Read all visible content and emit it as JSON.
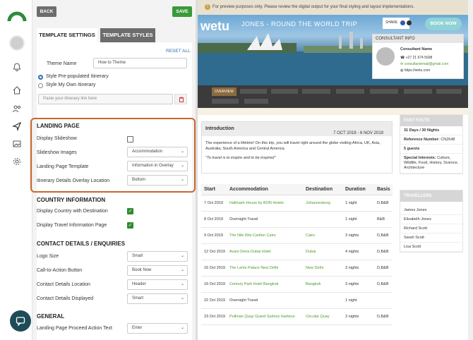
{
  "toolbar": {
    "back_label": "BACK",
    "save_label": "SAVE"
  },
  "tabs": [
    {
      "label": "TEMPLATE SETTINGS"
    },
    {
      "label": "TEMPLATE STYLES"
    }
  ],
  "form": {
    "reset_all": "RESET ALL",
    "theme_name_label": "Theme Name",
    "theme_name_value": "How to Theme",
    "radio_prepopulated": "Style Pre-populated Itinerary",
    "radio_own": "Style My Own Itinerary",
    "itinerary_link_placeholder": "Paste your itinerary link here",
    "landing_page": {
      "heading": "LANDING PAGE",
      "display_slideshow": "Display Slideshow",
      "slideshow_images": "Slideshow Images",
      "slideshow_images_value": "Accommodation",
      "landing_page_template": "Landing Page Template",
      "landing_page_template_value": "Information in Overlay",
      "overlay_location": "Itinerary Details Overlay Location",
      "overlay_location_value": "Bottom"
    },
    "country_info": {
      "heading": "COUNTRY INFORMATION",
      "display_country": "Display Country with Destination",
      "display_travel_info": "Display Travel Information Page"
    },
    "contact": {
      "heading": "CONTACT DETAILS / ENQUIRIES",
      "logo_size": "Logo Size",
      "logo_size_value": "Small",
      "cta_button": "Call-to-Action Button",
      "cta_button_value": "Book Now",
      "contact_location": "Contact Details Location",
      "contact_location_value": "Header",
      "contact_displayed": "Contact Details Displayed",
      "contact_displayed_value": "Smart"
    },
    "general": {
      "heading": "GENERAL",
      "proceed_action": "Landing Page Proceed Action Text",
      "proceed_action_value": "Enter"
    }
  },
  "preview": {
    "banner": "For preview purposes only. Please review the digital output for your final styling and layout implementations.",
    "logo": "wetu",
    "trip_title": "JONES - ROUND THE WORLD TRIP",
    "share_label": "SHARE",
    "book_now": "BOOK NOW",
    "consultant": {
      "title": "CONSULTANT INFO",
      "name": "Consultant Name",
      "phone": "+27 21 674 5698",
      "email": "consultantemail@gmail.com",
      "web": "https://wetu.com"
    },
    "nav_active": "OVERVIEW",
    "intro": {
      "title": "Introduction",
      "dates": "7 OCT 2019 - 6 NOV 2019",
      "body": "The experience of a lifetime! On this trip, you will travel right around the globe visiting Africa, UK, Asia, Australia, South America and Central America.",
      "quote": "\"To travel is to inspire and to be inspired\""
    },
    "table": {
      "headers": [
        "Start",
        "Accommodation",
        "Destination",
        "Duration",
        "Basis"
      ],
      "rows": [
        [
          "7 Oct 2019",
          "Hallmark House by BON Hotels",
          "Johannesburg",
          "1 night",
          "D,B&B"
        ],
        [
          "8 Oct 2019",
          "Overnight Travel",
          "",
          "1 night",
          "B&B"
        ],
        [
          "9 Oct 2019",
          "The Nile Ritz-Carlton Cairo",
          "Cairo",
          "3 nights",
          "D,B&B"
        ],
        [
          "12 Oct 2019",
          "Avani Deira Dubai Hotel",
          "Dubai",
          "4 nights",
          "D,B&B"
        ],
        [
          "16 Oct 2019",
          "The Lents Palace New Delhi",
          "New Delhi",
          "3 nights",
          "D,B&B"
        ],
        [
          "19 Oct 2019",
          "Century Park Hotel Bangkok",
          "Bangkok",
          "3 nights",
          "D,B&B"
        ],
        [
          "22 Oct 2019",
          "Overnight Travel",
          "",
          "1 night",
          ""
        ],
        [
          "23 Oct 2019",
          "Pullman Quay Grand Sydney Harbour",
          "Circular Quay",
          "3 nights",
          "D,B&B"
        ]
      ]
    },
    "fast_facts": {
      "title": "FAST FACTS",
      "duration": "31 Days / 30 Nights",
      "ref_label": "Reference Number:",
      "ref_value": "CN2648",
      "guests": "5 guests",
      "interests_label": "Special Interests:",
      "interests_value": "Culture, Wildlife, Food, History, Science, Architecture"
    },
    "travellers": {
      "title": "TRAVELLERS",
      "names": [
        "James Jones",
        "Elizabeth Jones",
        "Richard Scott",
        "Sarah Scott",
        "Lisa Scott"
      ]
    }
  }
}
